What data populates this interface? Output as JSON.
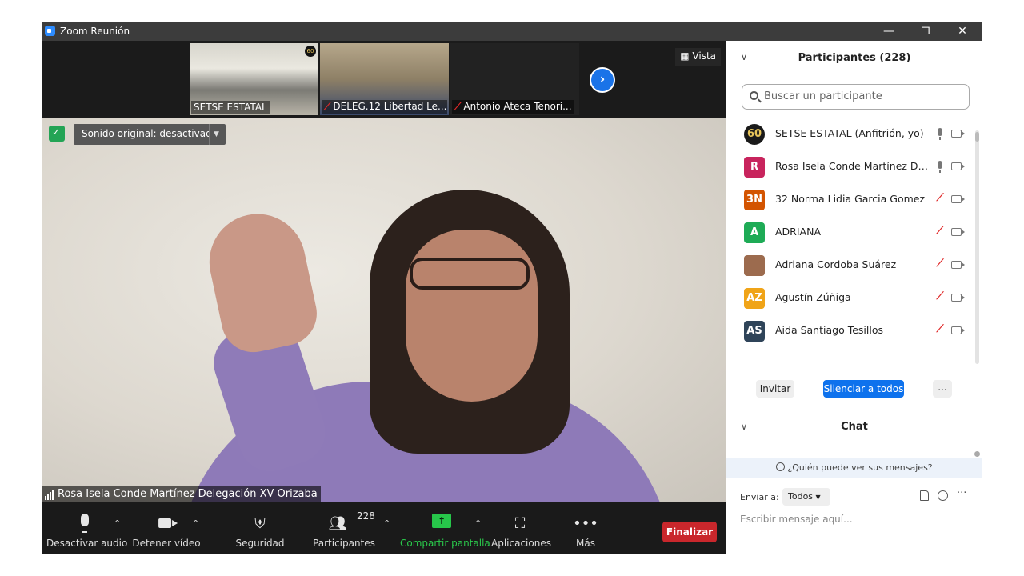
{
  "window": {
    "title": "Zoom Reunión",
    "minimize": "—",
    "restore": "❐",
    "close": "✕"
  },
  "thumbnails": [
    {
      "name": "SETSE ESTATAL",
      "muted": false
    },
    {
      "name": "DELEG.12 Libertad Le...",
      "muted": true
    },
    {
      "name": "Antonio Ateca Tenori...",
      "muted": true
    }
  ],
  "thumb_badge": "60",
  "vista_label": "Vista",
  "main_video": {
    "original_sound": "Sonido original: desactivado",
    "speaker_name": "Rosa Isela Conde Martínez Delegación XV Orizaba"
  },
  "toolbar": {
    "audio_label": "Desactivar audio",
    "video_label": "Detener vídeo",
    "security_label": "Seguridad",
    "participants_label": "Participantes",
    "participants_count": "228",
    "share_label": "Compartir pantalla",
    "apps_label": "Aplicaciones",
    "more_label": "Más",
    "end_label": "Finalizar"
  },
  "participants_panel": {
    "title": "Participantes (228)",
    "search_placeholder": "Buscar un participante",
    "items": [
      {
        "initials": "60",
        "name": "SETSE ESTATAL (Anfitrión, yo)",
        "color": "#1a1a1a",
        "mic": "on"
      },
      {
        "initials": "R",
        "name": "Rosa Isela Conde Martínez Delegación XV Orizaba",
        "color": "#c8245d",
        "mic": "on"
      },
      {
        "initials": "3N",
        "name": "32 Norma Lidia Garcia Gomez",
        "color": "#d35400",
        "mic": "off"
      },
      {
        "initials": "A",
        "name": "ADRIANA",
        "color": "#1eab56",
        "mic": "off"
      },
      {
        "initials": "",
        "name": "Adriana Cordoba Suárez",
        "color": "#9c6b4e",
        "mic": "off"
      },
      {
        "initials": "AZ",
        "name": "Agustín Zúñiga",
        "color": "#f0a418",
        "mic": "off"
      },
      {
        "initials": "AS",
        "name": "Aida Santiago Tesillos",
        "color": "#2f4459",
        "mic": "off"
      }
    ],
    "invite_label": "Invitar",
    "mute_all_label": "Silenciar a todos",
    "more_label": "..."
  },
  "chat_panel": {
    "title": "Chat",
    "who_sees": "¿Quién puede ver sus mensajes?",
    "send_to_label": "Enviar a:",
    "send_to_value": "Todos",
    "input_placeholder": "Escribir mensaje aquí..."
  },
  "colors": {
    "accent_blue": "#0e72ed",
    "end_red": "#c9272c",
    "share_green": "#27c64a",
    "mute_red": "#e02828"
  }
}
